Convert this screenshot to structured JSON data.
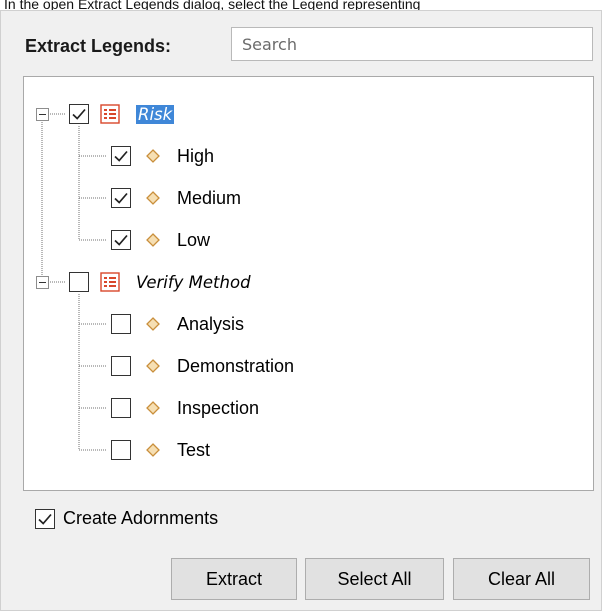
{
  "caption": "In the open Extract Legends dialog, select the Legend representing",
  "dialog": {
    "title_label": "Extract Legends:",
    "search_placeholder": "Search"
  },
  "tree": {
    "groups": [
      {
        "label": "Risk",
        "checked": true,
        "selected": true,
        "items": [
          {
            "label": "High",
            "checked": true
          },
          {
            "label": "Medium",
            "checked": true
          },
          {
            "label": "Low",
            "checked": true
          }
        ]
      },
      {
        "label": "Verify Method",
        "checked": false,
        "selected": false,
        "items": [
          {
            "label": "Analysis",
            "checked": false
          },
          {
            "label": "Demonstration",
            "checked": false
          },
          {
            "label": "Inspection",
            "checked": false
          },
          {
            "label": "Test",
            "checked": false
          }
        ]
      }
    ]
  },
  "options": {
    "create_adornments_label": "Create Adornments",
    "create_adornments_checked": true
  },
  "buttons": {
    "extract": "Extract",
    "select_all": "Select All",
    "clear_all": "Clear All"
  },
  "colors": {
    "selection": "#3f87d8",
    "diamond_fill": "#f6dfb3",
    "diamond_stroke": "#c98f3c",
    "legend_icon": "#d9472b"
  },
  "icons": {
    "group": "legend-list-icon",
    "item": "diamond-icon",
    "expander": "collapse-minus-icon"
  }
}
